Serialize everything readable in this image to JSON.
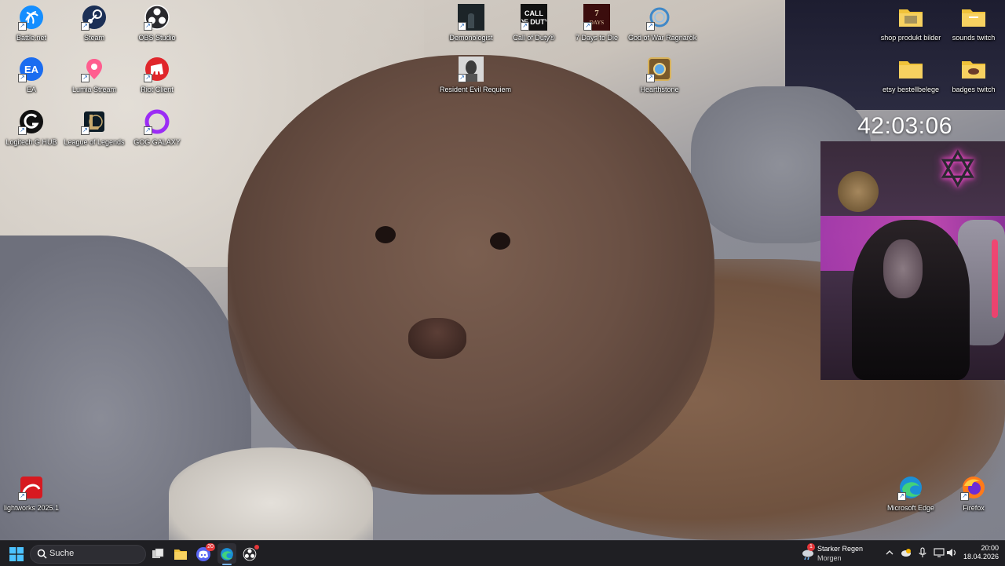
{
  "desktop": {
    "icons_left": [
      {
        "label": "Battle.net",
        "icon": "battlenet-icon"
      },
      {
        "label": "Steam",
        "icon": "steam-icon"
      },
      {
        "label": "OBS Studio",
        "icon": "obs-icon"
      },
      {
        "label": "EA",
        "icon": "ea-icon"
      },
      {
        "label": "Lumia Stream",
        "icon": "lumia-icon"
      },
      {
        "label": "Riot Client",
        "icon": "riot-icon"
      },
      {
        "label": "Logitech G HUB",
        "icon": "logitech-icon"
      },
      {
        "label": "League of Legends",
        "icon": "league-icon"
      },
      {
        "label": "GOG GALAXY",
        "icon": "gog-icon"
      }
    ],
    "icons_top": [
      {
        "label": "Demonologist",
        "icon": "demonologist-icon"
      },
      {
        "label": "Call of Duty®",
        "icon": "cod-icon",
        "art": "CALL OF DUTY"
      },
      {
        "label": "7 Days to Die",
        "icon": "7days-icon",
        "art": "7 DAYS TO DIE"
      },
      {
        "label": "God of War Ragnarök",
        "icon": "gow-icon"
      },
      {
        "label": "Resident Evil Requiem",
        "icon": "re-icon"
      },
      {
        "label": "Hearthstone",
        "icon": "hearthstone-icon"
      }
    ],
    "icons_right": [
      {
        "label": "shop produkt bilder",
        "icon": "folder-icon"
      },
      {
        "label": "sounds twitch",
        "icon": "folder-icon"
      },
      {
        "label": "etsy bestellbelege",
        "icon": "folder-icon"
      },
      {
        "label": "badges twitch",
        "icon": "folder-icon"
      }
    ],
    "icons_bottom": [
      {
        "label": "lightworks 2025.1",
        "icon": "lightworks-icon"
      },
      {
        "label": "Microsoft Edge",
        "icon": "edge-icon"
      },
      {
        "label": "Firefox",
        "icon": "firefox-icon"
      }
    ],
    "overlay_clock": "42:03:06"
  },
  "taskbar": {
    "search_placeholder": "Suche",
    "apps": [
      {
        "name": "task-view",
        "icon": "task-view-icon"
      },
      {
        "name": "file-explorer",
        "icon": "folder-icon"
      },
      {
        "name": "discord",
        "icon": "discord-icon",
        "badge": "20"
      },
      {
        "name": "edge",
        "icon": "edge-icon",
        "active": true
      },
      {
        "name": "obs",
        "icon": "obs-icon"
      }
    ],
    "weather": {
      "title": "Starker Regen",
      "subtitle": "Morgen",
      "badge": "1"
    },
    "tray_icons": [
      "chevron-up-icon",
      "cloud-icon",
      "microphone-icon",
      "display-icon",
      "speaker-icon",
      "battery-icon"
    ],
    "time": "20:00",
    "date": "18.04.2026"
  },
  "colors": {
    "taskbar_bg": "#1f1f23",
    "accent": "#78b4f4",
    "badge_red": "#e5373a"
  }
}
